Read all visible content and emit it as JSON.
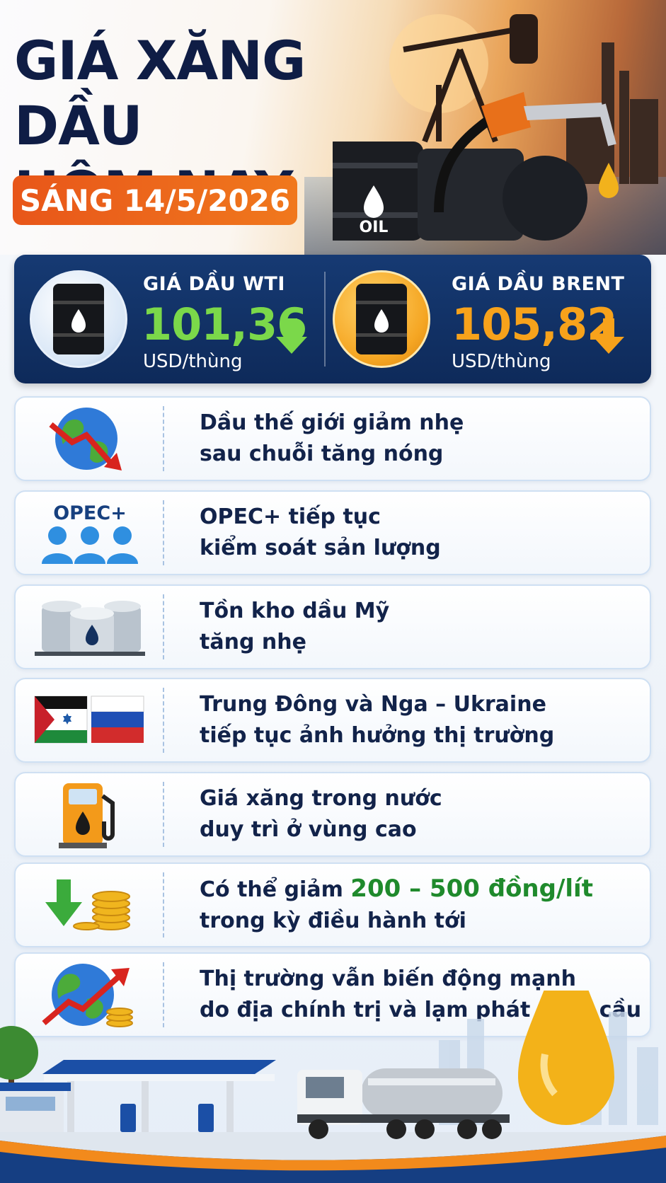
{
  "header": {
    "title_line1": "GIÁ XĂNG DẦU",
    "title_line2": "HÔM NAY",
    "date_badge": "SÁNG 14/5/2026",
    "barrel_label": "OIL"
  },
  "prices": {
    "wti": {
      "label": "GIÁ DẦU WTI",
      "value": "101,36",
      "unit": "USD/thùng",
      "trend": "down",
      "color": "#7bd84a"
    },
    "brent": {
      "label": "GIÁ DẦU BRENT",
      "value": "105,82",
      "unit": "USD/thùng",
      "trend": "down",
      "color": "#f7a21b"
    }
  },
  "news": [
    {
      "icon": "globe-down-trend-icon",
      "line1": "Dầu thế giới giảm nhẹ",
      "line2": "sau chuỗi tăng nóng"
    },
    {
      "icon": "opec-people-icon",
      "icon_text": "OPEC+",
      "line1": "OPEC+ tiếp tục",
      "line2": "kiểm soát sản lượng"
    },
    {
      "icon": "oil-tanks-icon",
      "line1": "Tồn kho dầu Mỹ",
      "line2": "tăng nhẹ"
    },
    {
      "icon": "flags-icon",
      "line1": "Trung Đông và Nga – Ukraine",
      "line2": "tiếp tục ảnh hưởng thị trường"
    },
    {
      "icon": "fuel-pump-icon",
      "line1": "Giá xăng trong nước",
      "line2": "duy trì ở vùng cao"
    },
    {
      "icon": "down-arrow-coins-icon",
      "line1_prefix": "Có thể giảm ",
      "line1_highlight": "200 – 500 đồng/lít",
      "line2": "trong kỳ điều hành tới"
    },
    {
      "icon": "globe-up-trend-coins-icon",
      "line1": "Thị trường vẫn biến động mạnh",
      "line2": "do địa chính trị và lạm phát toàn cầu"
    }
  ],
  "colors": {
    "navy": "#0f1d45",
    "orange": "#e8561a",
    "green": "#1f8a2c",
    "panel": "#163a73"
  }
}
